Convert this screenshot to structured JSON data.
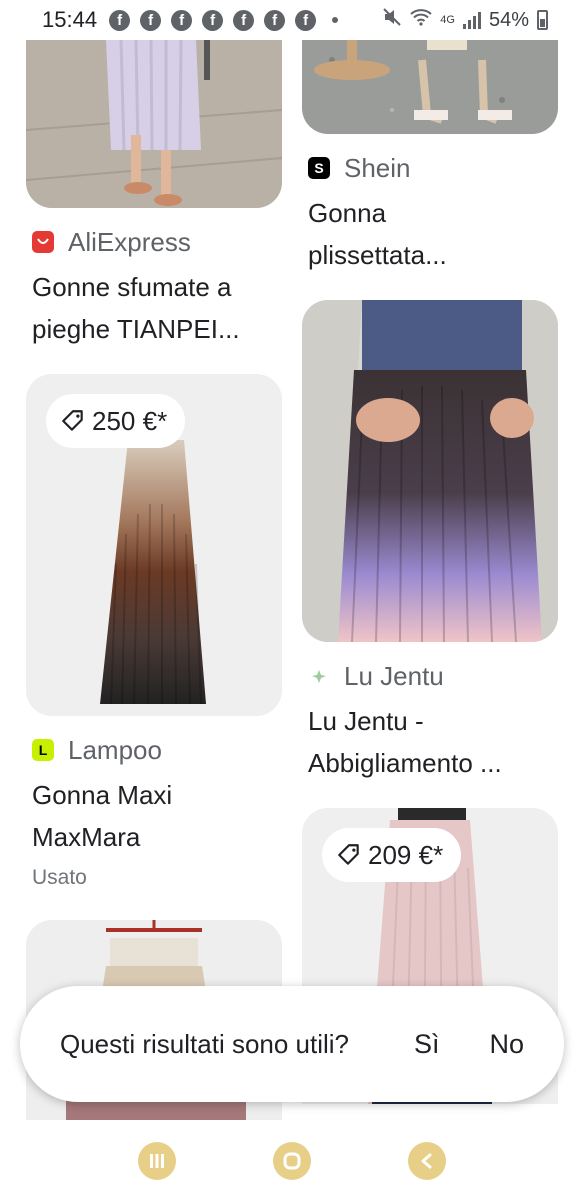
{
  "status_bar": {
    "time": "15:44",
    "app_icons": [
      "facebook-icon",
      "facebook-icon",
      "facebook-icon",
      "facebook-icon",
      "facebook-icon",
      "facebook-icon",
      "facebook-icon"
    ],
    "network": "4G",
    "battery": "54%"
  },
  "results": {
    "left": [
      {
        "source": "AliExpress",
        "source_color": "#e53935",
        "title_lines": [
          "Gonne sfumate a",
          "pieghe TIANPEI..."
        ]
      },
      {
        "price": "250 €*",
        "source": "Lampoo",
        "source_color": "#c6f000",
        "title_lines": [
          "Gonna Maxi",
          "MaxMara"
        ],
        "subtitle": "Usato"
      }
    ],
    "right": [
      {
        "source": "Shein",
        "source_color": "#000000",
        "title_lines": [
          "Gonna",
          "plissettata..."
        ]
      },
      {
        "source": "Lu Jentu",
        "source_color": "#9ccc9c",
        "title_lines": [
          "Lu Jentu -",
          "Abbigliamento ..."
        ]
      },
      {
        "price": "209 €*"
      }
    ]
  },
  "feedback": {
    "question": "Questi risultati sono utili?",
    "yes_label": "Sì",
    "no_label": "No"
  },
  "nav": [
    "recent-apps",
    "home",
    "back"
  ]
}
